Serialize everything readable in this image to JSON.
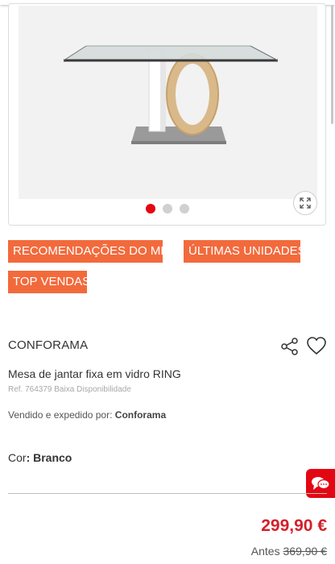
{
  "gallery": {
    "image_alt": "Mesa de jantar fixa em vidro RING",
    "dots": [
      {
        "active": true
      },
      {
        "active": false
      },
      {
        "active": false
      }
    ]
  },
  "tags": [
    "RECOMENDAÇÕES DO MÊS",
    "ÚLTIMAS UNIDADES",
    "TOP VENDAS"
  ],
  "product": {
    "brand": "CONFORAMA",
    "title": "Mesa de jantar fixa em vidro RING",
    "ref": "Ref. 764379 Baixa Disponibilidade",
    "sold_prefix": "Vendido e expedido por: ",
    "seller": "Conforama",
    "color_label": "Cor",
    "color_value": ": Branco",
    "price": "299,90 €",
    "before_label": "Antes ",
    "old_price": "369,90 €"
  },
  "colors": {
    "accent": "#e30613",
    "tag_bg": "#f26a3c",
    "price": "#d4202a"
  }
}
